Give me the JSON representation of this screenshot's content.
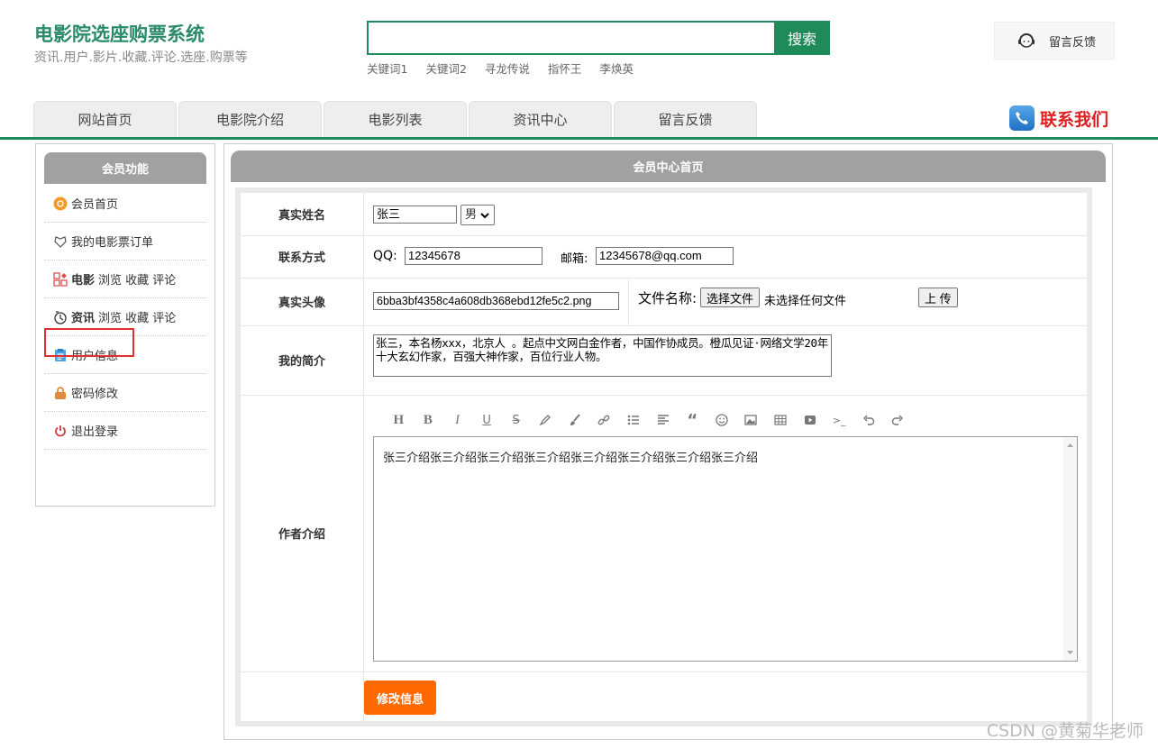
{
  "header": {
    "title": "电影院选座购票系统",
    "subtitle": "资讯.用户.影片.收藏.评论.选座.购票等",
    "search": {
      "placeholder": "",
      "button": "搜索"
    },
    "keywords": [
      "关键词1",
      "关键词2",
      "寻龙传说",
      "指怀王",
      "李焕英"
    ],
    "feedback": "留言反馈",
    "contact": "联系我们"
  },
  "nav": {
    "tabs": [
      "网站首页",
      "电影院介绍",
      "电影列表",
      "资讯中心",
      "留言反馈"
    ]
  },
  "sidebar": {
    "title": "会员功能",
    "items": [
      {
        "icon": "home-icon",
        "label": "会员首页"
      },
      {
        "icon": "ticket-order-icon",
        "label": "我的电影票订单"
      },
      {
        "icon": "movie-icon",
        "strong": "电影",
        "label": "浏览 收藏 评论"
      },
      {
        "icon": "news-icon",
        "strong": "资讯",
        "label": "浏览 收藏 评论"
      },
      {
        "icon": "user-info-icon",
        "label": "用户信息"
      },
      {
        "icon": "lock-icon",
        "label": "密码修改"
      },
      {
        "icon": "power-icon",
        "label": "退出登录"
      }
    ]
  },
  "main": {
    "title": "会员中心首页",
    "form": {
      "name_label": "真实姓名",
      "name_value": "张三",
      "gender_value": "男",
      "contact_label": "联系方式",
      "qq_label": "QQ:",
      "qq_value": "12345678",
      "email_label": "邮箱:",
      "email_value": "12345678@qq.com",
      "avatar_label": "真实头像",
      "avatar_value": "6bba3bf4358c4a608db368ebd12fe5c2.png",
      "file_label": "文件名称:",
      "choose_file": "选择文件",
      "no_file": "未选择任何文件",
      "upload": "上 传",
      "intro_label": "我的简介",
      "intro_value": "张三，本名杨xxx，北京人 。起点中文网白金作者，中国作协成员。橙瓜见证·网络文学20年十大玄幻作家，百强大神作家，百位行业人物。",
      "author_label": "作者介绍",
      "author_value": "张三介绍张三介绍张三介绍张三介绍张三介绍张三介绍张三介绍张三介绍",
      "submit": "修改信息"
    }
  },
  "watermark": "CSDN @黄菊华老师",
  "colors": {
    "brand": "#1f8a5a",
    "accent": "#ff6a00",
    "contact": "#e02020"
  }
}
